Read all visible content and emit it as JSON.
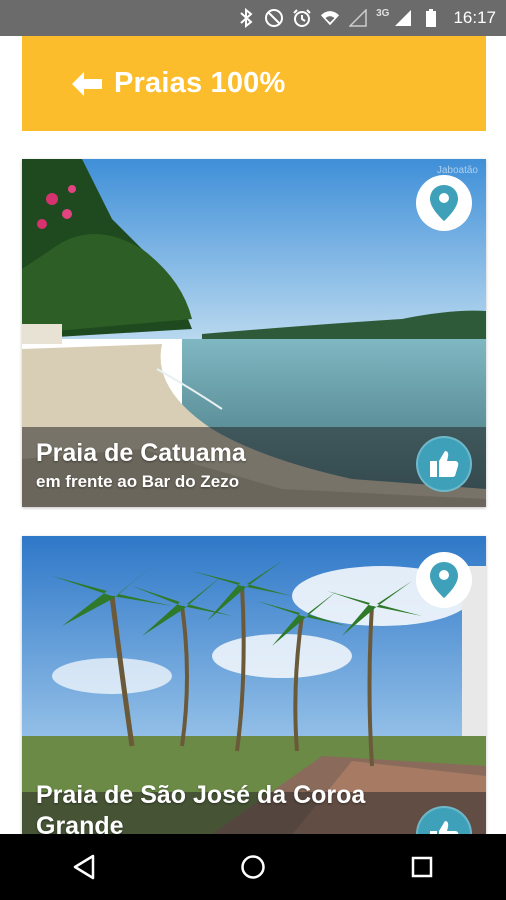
{
  "status_bar": {
    "time": "16:17",
    "network": "3G",
    "icons": [
      "bluetooth-icon",
      "do-not-disturb-icon",
      "alarm-icon",
      "wifi-icon",
      "signal-empty-icon",
      "signal-icon",
      "battery-icon"
    ]
  },
  "header": {
    "title": "Praias 100%",
    "back_icon": "arrow-left-icon",
    "background_color": "#fbbd2c"
  },
  "cards": [
    {
      "title": "Praia de Catuama",
      "subtitle": "em frente ao Bar do Zezo",
      "watermark": "Jaboatão",
      "location_icon": "map-pin-icon",
      "like_icon": "thumbs-up-icon"
    },
    {
      "title": "Praia de São José da Coroa Grande",
      "location_icon": "map-pin-icon",
      "like_icon": "thumbs-up-icon"
    }
  ],
  "nav_bar": {
    "icons": [
      "back-triangle-icon",
      "home-circle-icon",
      "recents-square-icon"
    ]
  },
  "colors": {
    "accent": "#fbbd2c",
    "icon_teal": "#3fa1b9"
  }
}
